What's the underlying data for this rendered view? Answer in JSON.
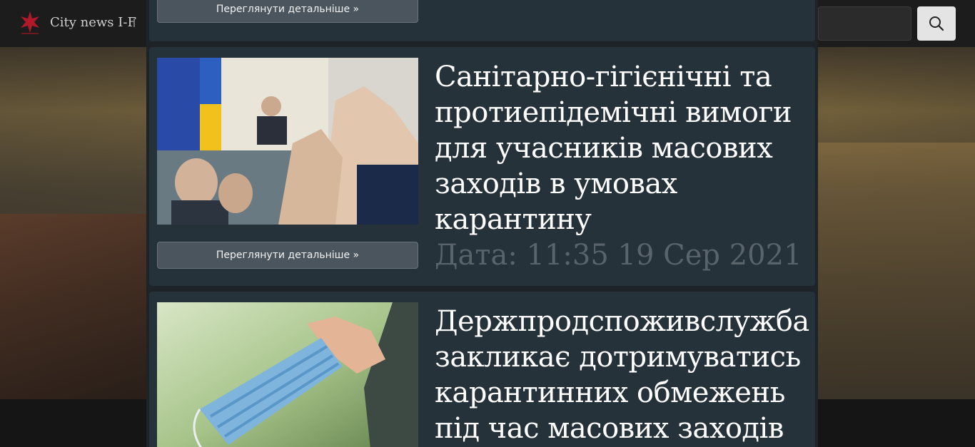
{
  "navbar": {
    "brand": "City news I-F",
    "search_placeholder": ""
  },
  "articles": [
    {
      "more_label": "Переглянути детальніше »"
    },
    {
      "title": "Санітарно-гігієнічні та протиепідемічні вимоги для учасників масових заходів в умовах карантину",
      "date": "Дата: 11:35 19 Сер 2021",
      "more_label": "Переглянути детальніше »"
    },
    {
      "title": "Держпродспоживслужба закликає дотримуватись карантинних обмежень під час масових заходів"
    }
  ],
  "colors": {
    "card": "#26323a",
    "button": "#4b555d",
    "date_text": "#59646a"
  }
}
